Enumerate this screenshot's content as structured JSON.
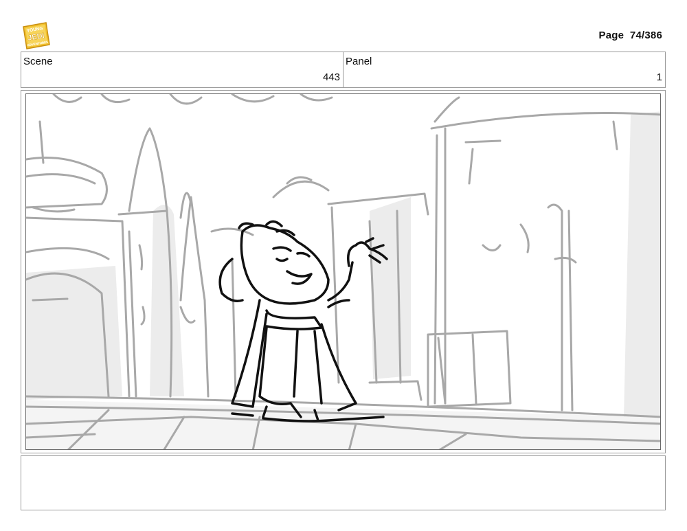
{
  "header": {
    "logo_icon": "young-jedi-adventures-logo",
    "logo_text": [
      "YOUNG",
      "JEDI",
      "ADVENTURES"
    ],
    "page_label": "Page",
    "page_number": "74/386"
  },
  "info": {
    "scene_label": "Scene",
    "scene_value": "443",
    "panel_label": "Panel",
    "panel_value": "1"
  },
  "panel": {
    "image_icon": "storyboard-sketch-jedi-character",
    "colors": {
      "sketch_gray": "#a8a8a8",
      "ink": "#111111",
      "wash": "#ececec"
    }
  },
  "notes": {}
}
